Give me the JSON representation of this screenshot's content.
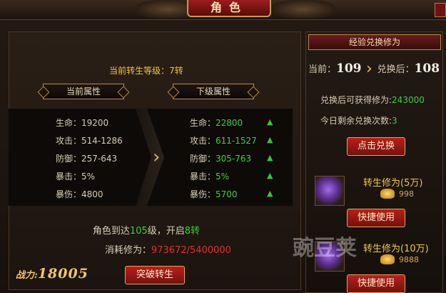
{
  "window": {
    "title": "角色"
  },
  "main": {
    "level_title": "当前转生等级：7转",
    "tabs": {
      "current": "当前属性",
      "next": "下级属性"
    },
    "current_stats": [
      {
        "label": "生命：",
        "value": "19200"
      },
      {
        "label": "攻击：",
        "value": "514-1286"
      },
      {
        "label": "防御：",
        "value": "257-643"
      },
      {
        "label": "暴击：",
        "value": "5%"
      },
      {
        "label": "暴伤：",
        "value": "4800"
      }
    ],
    "next_stats": [
      {
        "label": "生命：",
        "value": "22800"
      },
      {
        "label": "攻击：",
        "value": "611-1527"
      },
      {
        "label": "防御：",
        "value": "305-763"
      },
      {
        "label": "暴击：",
        "value": "5%"
      },
      {
        "label": "暴伤：",
        "value": "5700"
      }
    ],
    "unlock": {
      "prefix": "角色到达",
      "level": "105",
      "mid": "级，开启",
      "rebirth": "8转"
    },
    "cost": {
      "label": "消耗修为：",
      "value": "973672/5400000"
    },
    "power": {
      "label": "战力:",
      "value": "18005"
    },
    "breakthrough_button": "突破转生"
  },
  "side": {
    "header": "经验兑换修为",
    "current_label": "当前：",
    "current_value": "109",
    "after_label": "兑换后：",
    "after_value": "108",
    "gain_label": "兑换后可获得修为:",
    "gain_value": "243000",
    "remaining_label": "今日剩余兑换次数:",
    "remaining_value": "3",
    "exchange_button": "点击兑换",
    "items": [
      {
        "name": "转生修为(5万)",
        "price": "998",
        "button": "快捷使用"
      },
      {
        "name": "转生修为(10万)",
        "price": "9888",
        "button": "快捷使用"
      }
    ]
  },
  "watermark": {
    "text": "豌豆荚"
  },
  "colors": {
    "accent_red": "#b6201a",
    "gold": "#f0c765",
    "green": "#38d23a",
    "cost_red": "#e3312a"
  }
}
